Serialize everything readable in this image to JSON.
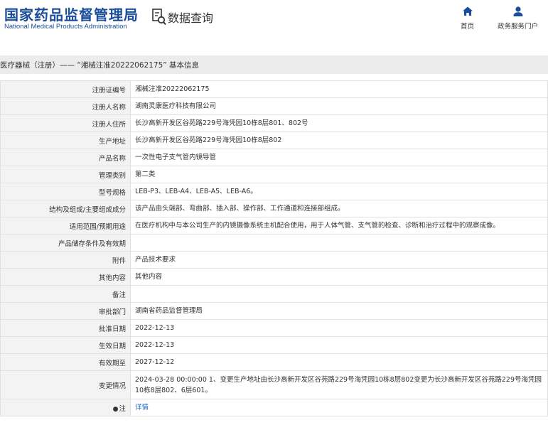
{
  "header": {
    "logo_cn": "国家药品监督管理局",
    "logo_en": "National Medical Products Administration",
    "query_label": "数据查询",
    "nav_home": "首页",
    "nav_service": "政务服务门户"
  },
  "breadcrumb": "医疗器械（注册）—— “湘械注准20222062175” 基本信息",
  "rows": [
    {
      "label": "注册证编号",
      "value": "湘械注准20222062175"
    },
    {
      "label": "注册人名称",
      "value": "湖南灵康医疗科技有限公司"
    },
    {
      "label": "注册人住所",
      "value": "长沙高新开发区谷苑路229号海凭园10栋8层801、802号"
    },
    {
      "label": "生产地址",
      "value": "长沙高新开发区谷苑路229号海凭园10栋8层802"
    },
    {
      "label": "产品名称",
      "value": "一次性电子支气管内镜导管"
    },
    {
      "label": "管理类别",
      "value": "第二类"
    },
    {
      "label": "型号规格",
      "value": "LEB-P3、LEB-A4、LEB-A5、LEB-A6。"
    },
    {
      "label": "结构及组成/主要组成成分",
      "value": "该产品由头端部、弯曲部、插入部、操作部、工作通道和连接部组成。"
    },
    {
      "label": "适用范围/预期用途",
      "value": "在医疗机构中与本公司生产的内镜摄像系统主机配合使用，用于人体气管、支气管的检查、诊断和治疗过程中的观察成像。"
    },
    {
      "label": "产品储存条件及有效期",
      "value": ""
    },
    {
      "label": "附件",
      "value": "产品技术要求"
    },
    {
      "label": "其他内容",
      "value": "其他内容"
    },
    {
      "label": "备注",
      "value": ""
    },
    {
      "label": "审批部门",
      "value": "湖南省药品监督管理局"
    },
    {
      "label": "批准日期",
      "value": "2022-12-13"
    },
    {
      "label": "生效日期",
      "value": "2022-12-13"
    },
    {
      "label": "有效期至",
      "value": "2027-12-12"
    },
    {
      "label": "变更情况",
      "value": "2024-03-28 00:00:00 1、变更生产地址由长沙高新开发区谷苑路229号海凭园10栋8层802变更为长沙高新开发区谷苑路229号海凭园10栋8层802、6层601。"
    }
  ],
  "note": {
    "icon": "pin-icon",
    "label": "注",
    "link": "详情"
  },
  "colors": {
    "brand": "#1a4d99",
    "link": "#1a66cc",
    "bar": "#ececec",
    "label_bg": "#f3f3f3"
  }
}
